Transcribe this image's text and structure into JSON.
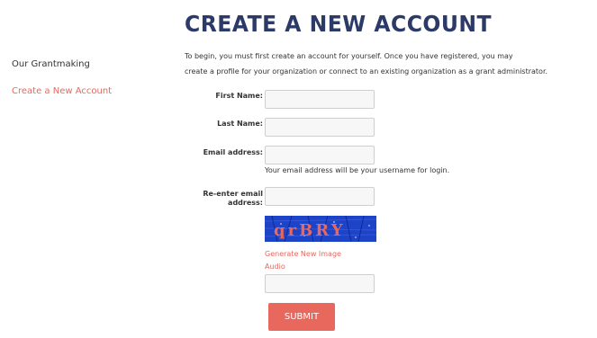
{
  "sidebar": {
    "items": [
      {
        "label": "Our Grantmaking"
      },
      {
        "label": "Create a New Account"
      }
    ]
  },
  "main": {
    "title": "CREATE A NEW ACCOUNT",
    "intro_line1": "To begin, you must first create an account for yourself. Once you have registered, you may",
    "intro_line2": "create a profile for your organization or connect to an existing organization as a grant administrator."
  },
  "form": {
    "first_name_label": "First Name:",
    "last_name_label": "Last Name:",
    "email_label": "Email address:",
    "email_hint": "Your email address will be your username for login.",
    "reenter_label_line1": "Re-enter email",
    "reenter_label_line2": "address:",
    "captcha_text": "qrBRY",
    "generate_link": "Generate New Image",
    "audio_link": "Audio",
    "submit_label": "SUBMIT",
    "first_name_value": "",
    "last_name_value": "",
    "email_value": "",
    "reenter_value": "",
    "captcha_value": ""
  },
  "colors": {
    "accent": "#e8685e",
    "title": "#2b3a67",
    "captcha_bg": "#1d43c7"
  }
}
